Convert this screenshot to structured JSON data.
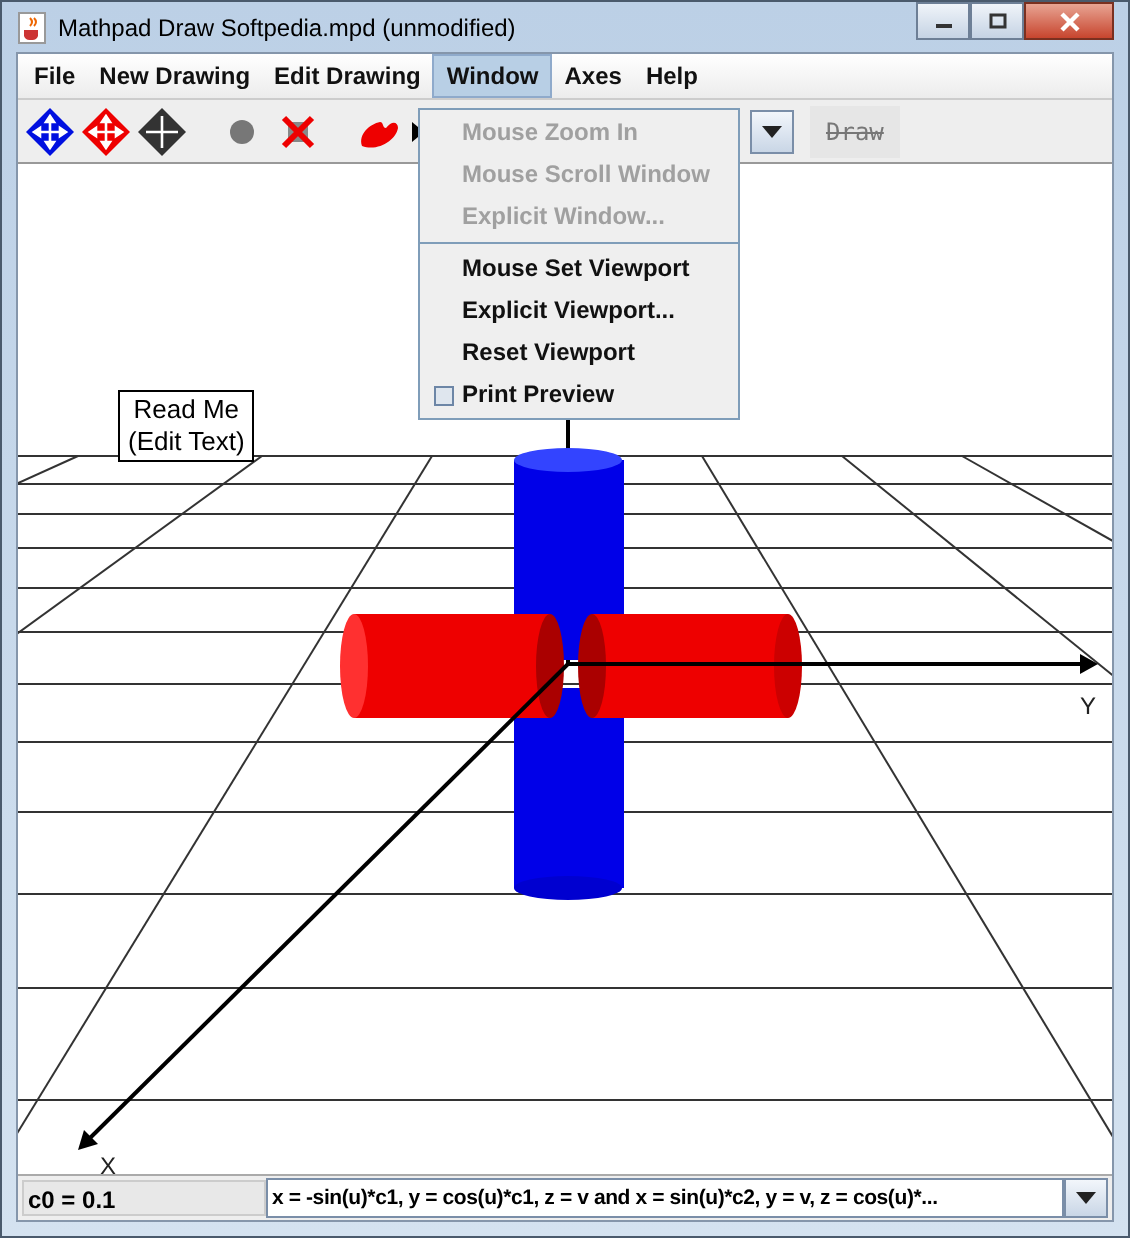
{
  "window": {
    "title": "Mathpad Draw Softpedia.mpd (unmodified)"
  },
  "menu_bar": [
    {
      "label": "File",
      "selected": false
    },
    {
      "label": "New Drawing",
      "selected": false
    },
    {
      "label": "Edit Drawing",
      "selected": false
    },
    {
      "label": "Window",
      "selected": true
    },
    {
      "label": "Axes",
      "selected": false
    },
    {
      "label": "Help",
      "selected": false
    }
  ],
  "toolbar": {
    "draw_button": {
      "label": "Draw",
      "disabled": true
    }
  },
  "window_menu": [
    {
      "kind": "item",
      "label": "Mouse Zoom In",
      "disabled": true
    },
    {
      "kind": "item",
      "label": "Mouse Scroll Window",
      "disabled": true
    },
    {
      "kind": "item",
      "label": "Explicit Window...",
      "disabled": true
    },
    {
      "kind": "separator"
    },
    {
      "kind": "item",
      "label": "Mouse Set Viewport",
      "disabled": false
    },
    {
      "kind": "item",
      "label": "Explicit Viewport...",
      "disabled": false
    },
    {
      "kind": "item",
      "label": "Reset Viewport",
      "disabled": false
    },
    {
      "kind": "check",
      "label": "Print Preview",
      "checked": false,
      "disabled": false
    }
  ],
  "canvas": {
    "text_box": [
      "Read Me",
      "(Edit Text)"
    ],
    "y_axis_label": "Y",
    "x_axis_label": "X"
  },
  "status_bar": {
    "constant": "c0 = 0.1",
    "equation": "x = -sin(u)*c1, y = cos(u)*c1, z = v and x = sin(u)*c2, y = v, z = cos(u)*..."
  }
}
